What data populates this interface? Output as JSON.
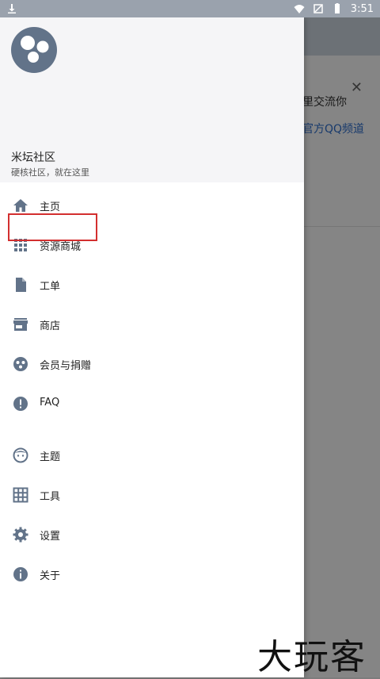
{
  "status_bar": {
    "time": "3:51"
  },
  "background_card": {
    "line1": "里交流你",
    "line2": "官方QQ频道"
  },
  "drawer": {
    "header": {
      "title": "米坛社区",
      "subtitle": "硬核社区，就在这里"
    },
    "menu": [
      {
        "label": "主页",
        "icon": "home-icon"
      },
      {
        "label": "资源商城",
        "icon": "apps-grid-icon"
      },
      {
        "label": "工单",
        "icon": "document-icon"
      },
      {
        "label": "商店",
        "icon": "store-icon"
      },
      {
        "label": "会员与捐赠",
        "icon": "community-icon"
      },
      {
        "label": "FAQ",
        "icon": "info-exclamation-icon"
      },
      {
        "label": "主题",
        "icon": "face-icon"
      },
      {
        "label": "工具",
        "icon": "tools-grid-icon"
      },
      {
        "label": "设置",
        "icon": "gear-icon"
      },
      {
        "label": "关于",
        "icon": "info-icon"
      }
    ]
  },
  "watermark": "大玩客",
  "colors": {
    "icon": "#627389",
    "highlight": "#d32f2f",
    "link": "#2f6fcf"
  }
}
